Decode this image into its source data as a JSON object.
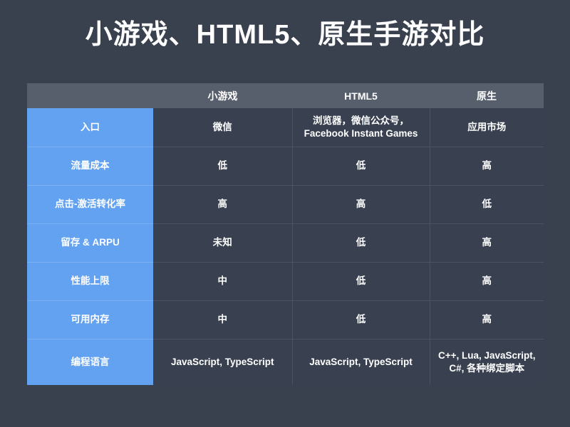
{
  "slide": {
    "title": "小游戏、HTML5、原生手游对比",
    "background_color": "#39414f",
    "accent_color": "#63a2f0",
    "header_color": "#575e6c",
    "cell_color": "#394150"
  },
  "table": {
    "headers": [
      "",
      "小游戏",
      "HTML5",
      "原生"
    ],
    "rows": [
      {
        "label": "入口",
        "cells": [
          "微信",
          "浏览器，微信公众号，\nFacebook Instant Games",
          "应用市场"
        ]
      },
      {
        "label": "流量成本",
        "cells": [
          "低",
          "低",
          "高"
        ]
      },
      {
        "label": "点击-激活转化率",
        "cells": [
          "高",
          "高",
          "低"
        ]
      },
      {
        "label": "留存 & ARPU",
        "cells": [
          "未知",
          "低",
          "高"
        ]
      },
      {
        "label": "性能上限",
        "cells": [
          "中",
          "低",
          "高"
        ]
      },
      {
        "label": "可用内存",
        "cells": [
          "中",
          "低",
          "高"
        ]
      },
      {
        "label": "编程语言",
        "cells": [
          "JavaScript, TypeScript",
          "JavaScript, TypeScript",
          "C++, Lua, JavaScript,\nC#, 各种绑定脚本"
        ]
      }
    ]
  }
}
